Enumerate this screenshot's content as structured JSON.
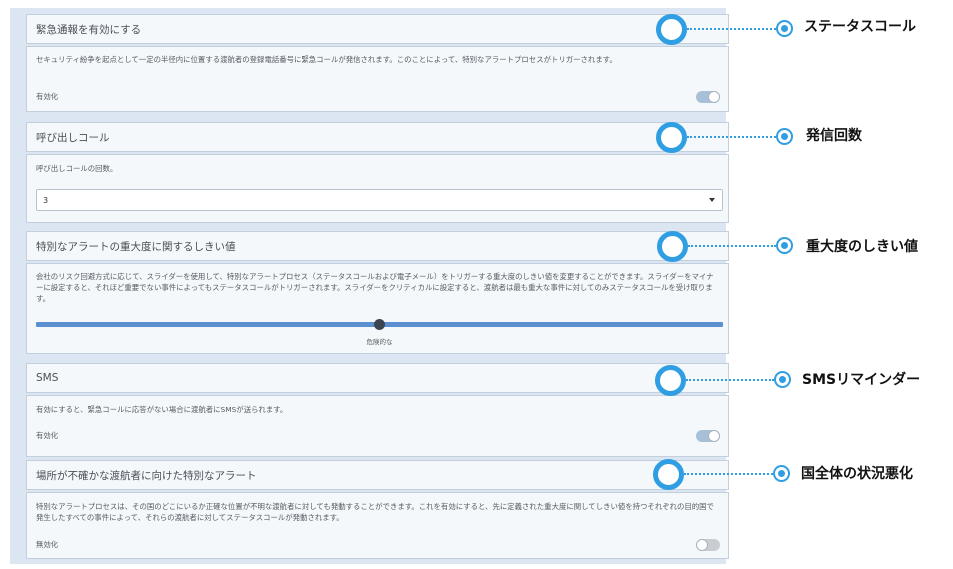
{
  "sections": [
    {
      "title": "緊急通報を有効にする",
      "description": "セキュリティ紛争を起点として一定の半径内に位置する渡航者の登録電話番号に緊急コールが発信されます。このことによって、特別なアラートプロセスがトリガーされます。",
      "toggle_label": "有効化",
      "toggle_on": true
    },
    {
      "title": "呼び出しコール",
      "description": "呼び出しコールの回数。",
      "select_value": "3"
    },
    {
      "title": "特別なアラートの重大度に関するしきい値",
      "description": "会社のリスク回避方式に応じて、スライダーを使用して、特別なアラートプロセス（ステータスコールおよび電子メール）をトリガーする重大度のしきい値を変更することができます。スライダーをマイナーに設定すると、それほど重要でない事件によってもステータスコールがトリガーされます。スライダーをクリティカルに設定すると、渡航者は最も重大な事件に対してのみステータスコールを受け取ります。",
      "slider_label": "危険的な",
      "slider_value": 0.5
    },
    {
      "title": "SMS",
      "description": "有効にすると、緊急コールに応答がない場合に渡航者にSMSが送られます。",
      "toggle_label": "有効化",
      "toggle_on": true
    },
    {
      "title": "場所が不確かな渡航者に向けた特別なアラート",
      "description": "特別なアラートプロセスは、その国のどこにいるか正確な位置が不明な渡航者に対しても発動することができます。これを有効にすると、先に定義された重大度に関してしきい値を持つそれぞれの目的国で発生したすべての事件によって、それらの渡航者に対してステータスコールが発動されます。",
      "toggle_label": "無効化",
      "toggle_on": false
    }
  ],
  "annotations": [
    "ステータスコール",
    "発信回数",
    "重大度のしきい値",
    "SMSリマインダー",
    "国全体の状況悪化"
  ],
  "colors": {
    "accent": "#2f9ee2",
    "panel_bg": "#dce6f3",
    "slider": "#5b8fd0"
  }
}
